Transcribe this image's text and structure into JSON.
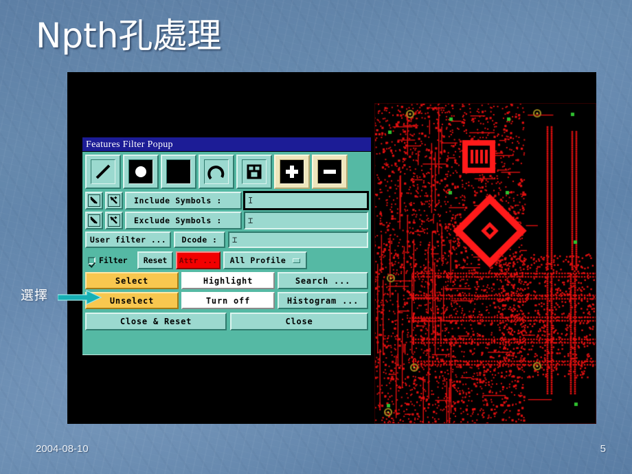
{
  "slide": {
    "title": "Npth孔處理",
    "footer_date": "2004-08-10",
    "page_number": "5",
    "background_color": "#5d7fa5",
    "title_color": "#ffffff"
  },
  "annotation": {
    "label": "選擇",
    "arrow_color": "#17b0b5",
    "points_to": "Select"
  },
  "dialog": {
    "title": "Features Filter Popup",
    "titlebar_color": "#1c1c96",
    "surface_color": "#55b9a4",
    "control_color": "#9bd9cf",
    "toolbar": [
      {
        "name": "line-tool",
        "glyph": "line",
        "style": "plain",
        "selected": false
      },
      {
        "name": "pad-tool",
        "glyph": "pad",
        "style": "black",
        "selected": false
      },
      {
        "name": "surface-tool",
        "glyph": "surface",
        "style": "black",
        "selected": false
      },
      {
        "name": "arc-tool",
        "glyph": "arc",
        "style": "plain",
        "selected": false
      },
      {
        "name": "text-tool",
        "glyph": "text",
        "style": "plain",
        "selected": false
      },
      {
        "name": "plus-tool",
        "glyph": "plus",
        "style": "cream",
        "selected": true
      },
      {
        "name": "minus-tool",
        "glyph": "minus",
        "style": "cream",
        "selected": true
      }
    ],
    "include_row": {
      "pick_button": "arrow-pick",
      "pick_add_button": "arrow-pick-add",
      "label": "Include Symbols :",
      "value": "",
      "placeholder": "",
      "focused": true
    },
    "exclude_row": {
      "pick_button": "arrow-pick",
      "pick_add_button": "arrow-pick-add",
      "label": "Exclude Symbols :",
      "value": "",
      "placeholder": "",
      "focused": false
    },
    "user_filter_button": "User filter ...",
    "dcode_label": "Dcode :",
    "dcode_value": "",
    "filter_checkbox": {
      "label": "Filter",
      "checked": true
    },
    "reset_button": "Reset",
    "attr_button": {
      "label": "Attr ...",
      "bg": "#f20000",
      "fg": "#7a0000"
    },
    "profile_option": {
      "label": "All Profile",
      "selected": "All Profile"
    },
    "actions": [
      {
        "label": "Select",
        "style": "gold"
      },
      {
        "label": "Highlight",
        "style": "white"
      },
      {
        "label": "Search ...",
        "style": "teal"
      },
      {
        "label": "Unselect",
        "style": "gold"
      },
      {
        "label": "Turn off",
        "style": "white"
      },
      {
        "label": "Histogram ...",
        "style": "teal"
      }
    ],
    "close_reset_button": "Close & Reset",
    "close_button": "Close"
  },
  "cam_view": {
    "background": "#000000",
    "trace_color": "#e01010",
    "marker_color": "#2fc02f",
    "highlight_color": "#ff1a1a",
    "cursor": "compass-crosshair-cursor"
  }
}
